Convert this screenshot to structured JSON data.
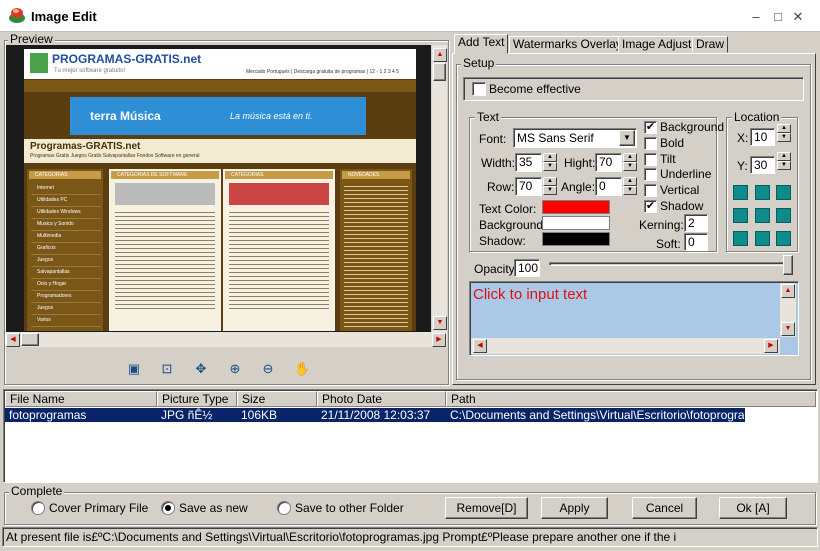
{
  "window": {
    "title": "Image Edit",
    "minimize": "–",
    "maximize": "□",
    "close": "✕"
  },
  "preview": {
    "label": "Preview",
    "site": {
      "logo": "PROGRAMAS-GRATIS.net",
      "tagline": "Tu mejor software gratuito!",
      "nav": "Mercado Portugués | Descarga gratuita de programas | 12 - 1 2 3 4 5",
      "banner_brand": "terra Música",
      "banner_slogan": "La música está en ti.",
      "page_title": "Programas-GRATIS.net",
      "breadcrumb": "Programas Gratis  Juegos Gratis  Salvapantallas  Fondos  Software en general",
      "sidebar_heading": "CATEGORIAS",
      "sidebar_items": [
        "Internet",
        "Utilidades PC",
        "Utilidades Windows",
        "Musica y Sonido",
        "Multimedia",
        "Graficos",
        "Juegos",
        "Salvapantallas",
        "Ocio y Hogar",
        "Programadores",
        "Juegos",
        "Varios"
      ],
      "col1_heading": "CATEGORIAS DE SOFTWARE",
      "col2_heading": "CATEGORIAS",
      "right_heading": "NOVEDADES"
    },
    "tools": [
      "image-icon",
      "fit-icon",
      "actual-size-icon",
      "zoom-in-icon",
      "zoom-out-icon",
      "hand-icon"
    ]
  },
  "tabs": [
    {
      "label": "Add Text",
      "active": true
    },
    {
      "label": "Watermarks Overlay",
      "active": false
    },
    {
      "label": "Image Adjust",
      "active": false
    },
    {
      "label": "Draw",
      "active": false
    }
  ],
  "setup": {
    "label": "Setup",
    "become_effective": "Become effective",
    "text_group": "Text",
    "font_label": "Font:",
    "font_value": "MS Sans Serif",
    "width_label": "Width:",
    "width_value": "35",
    "height_label": "Hight:",
    "height_value": "70",
    "row_label": "Row:",
    "row_value": "70",
    "angle_label": "Angle:",
    "angle_value": "0",
    "text_color_label": "Text Color:",
    "background_label": "Background",
    "shadow_label": "Shadow:",
    "colors": {
      "text": "#ff0000",
      "background": "#ffffff",
      "shadow": "#000000"
    },
    "options": [
      {
        "label": "Background",
        "checked": true
      },
      {
        "label": "Bold",
        "checked": false
      },
      {
        "label": "Tilt",
        "checked": false
      },
      {
        "label": "Underline",
        "checked": false
      },
      {
        "label": "Vertical",
        "checked": false
      },
      {
        "label": "Shadow",
        "checked": true
      }
    ],
    "kerning_label": "Kerning:",
    "kerning_value": "2",
    "soft_label": "Soft:",
    "soft_value": "0",
    "location_group": "Location",
    "x_label": "X:",
    "x_value": "10",
    "y_label": "Y:",
    "y_value": "30",
    "opacity_label": "Opacity:",
    "opacity_value": "100",
    "opacity_fraction": 1.0,
    "text_placeholder": "Click to input text"
  },
  "files": {
    "columns": [
      "File Name",
      "Picture Type",
      "Size",
      "Photo Date",
      "Path"
    ],
    "rows": [
      {
        "name": "fotoprogramas",
        "type": "JPG ñÊ½",
        "size": "106KB",
        "date": "21/11/2008 12:03:37",
        "path": "C:\\Documents and Settings\\Virtual\\Escritorio\\fotoprogram..."
      }
    ]
  },
  "complete": {
    "label": "Complete",
    "cover_primary": "Cover Primary File",
    "save_as_new": "Save as new",
    "save_other": "Save to other Folder",
    "remove_button": "Remove[D]",
    "apply_button": "Apply",
    "cancel_button": "Cancel",
    "ok_button": "Ok [A]"
  },
  "status": "At present file is£ºC:\\Documents and Settings\\Virtual\\Escritorio\\fotoprogramas.jpg  Prompt£ºPlease prepare another one if the i"
}
